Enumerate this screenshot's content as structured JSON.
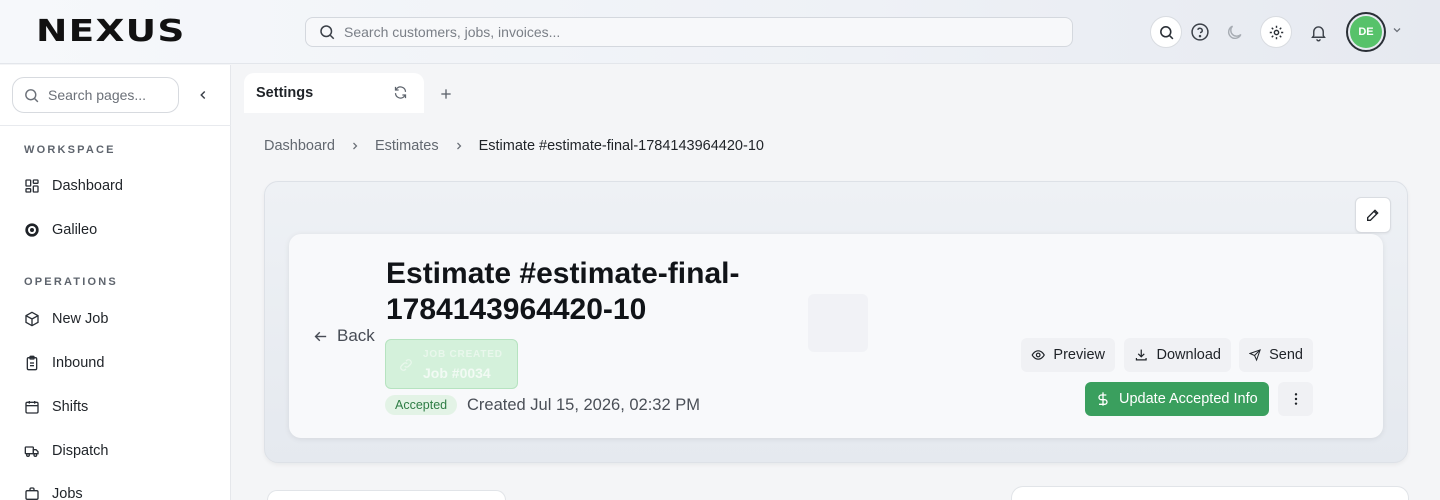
{
  "header": {
    "logo": "NEXUS",
    "search_placeholder": "Search customers, jobs, invoices...",
    "icons": [
      "search-icon",
      "help-icon",
      "moon-icon",
      "gear-icon",
      "bell-icon"
    ],
    "avatar_initials": "DE",
    "avatar_color": "#57c26a"
  },
  "sidebar": {
    "search_placeholder": "Search pages...",
    "sections": [
      {
        "label": "WORKSPACE",
        "items": [
          {
            "label": "Dashboard",
            "icon": "grid-icon"
          },
          {
            "label": "Galileo",
            "icon": "target-icon"
          }
        ]
      },
      {
        "label": "OPERATIONS",
        "items": [
          {
            "label": "New Job",
            "icon": "box-icon"
          },
          {
            "label": "Inbound",
            "icon": "clipboard-icon"
          },
          {
            "label": "Shifts",
            "icon": "calendar-icon"
          },
          {
            "label": "Dispatch",
            "icon": "truck-icon"
          },
          {
            "label": "Jobs",
            "icon": "briefcase-icon"
          }
        ]
      }
    ]
  },
  "tabs": [
    {
      "label": "Settings",
      "active": true
    }
  ],
  "breadcrumb": [
    "Dashboard",
    "Estimates",
    "Estimate #estimate-final-1784143964420-10"
  ],
  "estimate": {
    "back_label": "Back",
    "title": "Estimate #estimate-final-1784143964420-10",
    "job_badge_label": "JOB CREATED",
    "job_badge_value": "Job #0034",
    "status": "Accepted",
    "created": "Created Jul 15, 2026, 02:32 PM",
    "actions": {
      "preview": "Preview",
      "download": "Download",
      "send": "Send",
      "primary": "Update Accepted Info"
    },
    "accent_color": "#3a9f5e"
  }
}
